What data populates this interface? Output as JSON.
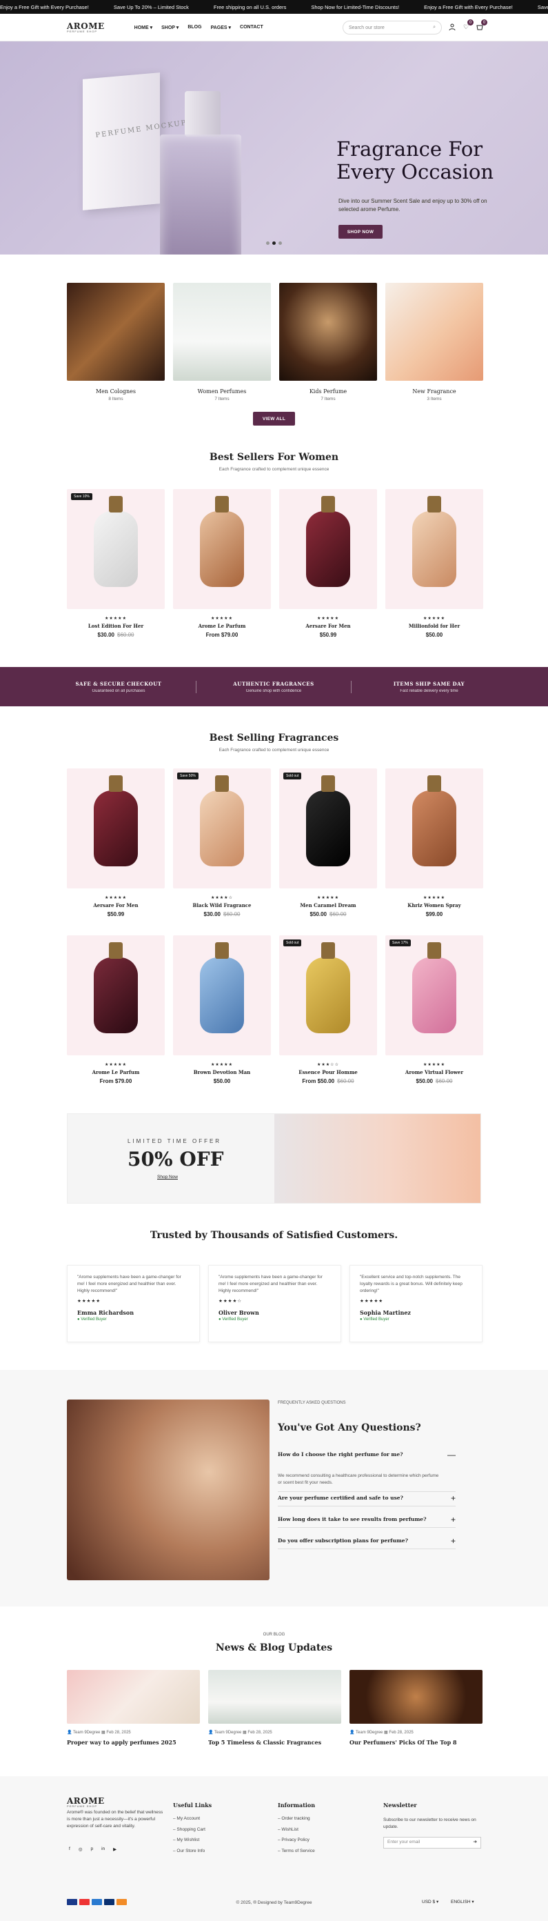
{
  "topbar": {
    "items": [
      "Enjoy a Free Gift with Every Purchase!",
      "Save Up To 20% – Limited Stock",
      "Free shipping on all U.S. orders",
      "Shop Now for Limited-Time Discounts!",
      "Enjoy a Free Gift with Every Purchase!",
      "Save Up To 20% – Limited Stock"
    ]
  },
  "header": {
    "logo": "AROME",
    "logo_sub": "PERFUME SHOP",
    "nav": [
      "HOME",
      "SHOP",
      "BLOG",
      "PAGES",
      "CONTACT"
    ],
    "search_placeholder": "Search our store",
    "wishlist_count": "0",
    "cart_count": "0"
  },
  "hero": {
    "box_label": "PERFUME MOCKUP",
    "bottle_label": "PERFUME MOCKUP",
    "title": "Fragrance For Every Occasion",
    "text": "Dive into our Summer Scent Sale and enjoy up to 30% off on selected arome Perfume.",
    "button": "SHOP NOW"
  },
  "categories": {
    "items": [
      {
        "name": "Men Colognes",
        "count": "8 Items"
      },
      {
        "name": "Women Perfumes",
        "count": "7 Items"
      },
      {
        "name": "Kids Perfume",
        "count": "7 Items"
      },
      {
        "name": "New Fragrance",
        "count": "3 Items"
      }
    ],
    "button": "VIEW ALL"
  },
  "bestsellers": {
    "title": "Best Sellers For Women",
    "subtitle": "Each Fragrance crafted to complement unique essence",
    "products": [
      {
        "tag": "Save 10%",
        "stars": "★★★★★",
        "name": "Lost Edition For Her",
        "price": "$30.00",
        "old": "$60.00"
      },
      {
        "tag": "",
        "stars": "★★★★★",
        "name": "Arome Le Parfum",
        "price": "From $79.00",
        "old": ""
      },
      {
        "tag": "",
        "stars": "★★★★★",
        "name": "Aersare For Men",
        "price": "$50.99",
        "old": ""
      },
      {
        "tag": "",
        "stars": "★★★★★",
        "name": "Millionfold for Her",
        "price": "$50.00",
        "old": ""
      }
    ]
  },
  "features": [
    {
      "title": "SAFE & SECURE CHECKOUT",
      "text": "Guaranteed on all purchases"
    },
    {
      "title": "AUTHENTIC FRAGRANCES",
      "text": "Genuine shop with confidence"
    },
    {
      "title": "ITEMS SHIP SAME DAY",
      "text": "Fast reliable delivery every time"
    }
  ],
  "bestselling": {
    "title": "Best Selling Fragrances",
    "subtitle": "Each Fragrance crafted to complement unique essence",
    "row1": [
      {
        "tag": "",
        "stars": "★★★★★",
        "name": "Aersare For Men",
        "price": "$50.99",
        "old": ""
      },
      {
        "tag": "Save 50%",
        "stars": "★★★★☆",
        "name": "Black Wild Fragrance",
        "price": "$30.00",
        "old": "$60.00"
      },
      {
        "tag": "Sold out",
        "stars": "★★★★★",
        "name": "Men Caramel Dream",
        "price": "$50.00",
        "old": "$60.00"
      },
      {
        "tag": "",
        "stars": "★★★★★",
        "name": "Khriz Women Spray",
        "price": "$99.00",
        "old": ""
      }
    ],
    "row2": [
      {
        "tag": "",
        "stars": "★★★★★",
        "name": "Arome Le Parfum",
        "price": "From $79.00",
        "old": ""
      },
      {
        "tag": "",
        "stars": "★★★★★",
        "name": "Brown Devotion Man",
        "price": "$50.00",
        "old": ""
      },
      {
        "tag": "Sold out",
        "stars": "★★★☆☆",
        "name": "Essence Pour Homme",
        "price": "From $50.00",
        "old": "$60.00"
      },
      {
        "tag": "Save 17%",
        "stars": "★★★★★",
        "name": "Arome Virtual Flower",
        "price": "$50.00",
        "old": "$60.00"
      }
    ]
  },
  "offer": {
    "eyebrow": "LIMITED TIME OFFER",
    "title": "50% OFF",
    "link": "Shop Now"
  },
  "testimonials": {
    "title": "Trusted by Thousands of Satisfied Customers.",
    "items": [
      {
        "text": "\"Arome supplements have been a game-changer for me! I feel more energized and healthier than ever. Highly recommend!\"",
        "stars": "★★★★★",
        "name": "Emma Richardson",
        "badge": "Verified Buyer"
      },
      {
        "text": "\"Arome supplements have been a game-changer for me! I feel more energized and healthier than ever. Highly recommend!\"",
        "stars": "★★★★☆",
        "name": "Oliver Brown",
        "badge": "Verified Buyer"
      },
      {
        "text": "\"Excellent service and top-notch supplements. The loyalty rewards is a great bonus. Will definitely keep ordering!\"",
        "stars": "★★★★★",
        "name": "Sophia Martinez",
        "badge": "Verified Buyer"
      }
    ]
  },
  "faq": {
    "eyebrow": "FREQUENTLY ASKED QUESTIONS",
    "title": "You've Got Any Questions?",
    "items": [
      {
        "q": "How do I choose the right perfume for me?",
        "a": "We recommend consulting a healthcare professional to determine which perfume or scent best fit your needs.",
        "icon": "—"
      },
      {
        "q": "Are your perfume certified and safe to use?",
        "a": "",
        "icon": "+"
      },
      {
        "q": "How long does it take to see results from perfume?",
        "a": "",
        "icon": "+"
      },
      {
        "q": "Do you offer subscription plans for perfume?",
        "a": "",
        "icon": "+"
      }
    ]
  },
  "blog": {
    "eyebrow": "OUR BLOG",
    "title": "News & Blog Updates",
    "posts": [
      {
        "author": "Team 9Degree",
        "date": "Feb 28, 2025",
        "title": "Proper way to apply perfumes 2025"
      },
      {
        "author": "Team 9Degree",
        "date": "Feb 28, 2025",
        "title": "Top 5 Timeless & Classic Fragrances"
      },
      {
        "author": "Team 9Degree",
        "date": "Feb 28, 2025",
        "title": "Our Perfumers' Picks Of The Top 8"
      }
    ]
  },
  "footer": {
    "logo": "AROME",
    "logo_sub": "PERFUME SHOP",
    "about": "Arome® was founded on the belief that wellness is more than just a necessity—it's a powerful expression of self-care and vitality.",
    "social": [
      "f",
      "◎",
      "p",
      "in",
      "▶"
    ],
    "useful_title": "Useful Links",
    "useful": [
      "My Account",
      "Shopping Cart",
      "My Wishlist",
      "Our Store Info"
    ],
    "info_title": "Information",
    "info": [
      "Order tracking",
      "WishList",
      "Privacy Policy",
      "Terms of Service"
    ],
    "news_title": "Newsletter",
    "news_text": "Subscribe to our newsletter to receive news on update.",
    "email_placeholder": "Enter your email",
    "copyright": "© 2025, ® Designed by Team9Degree",
    "currency": "USD $",
    "language": "ENGLISH"
  }
}
